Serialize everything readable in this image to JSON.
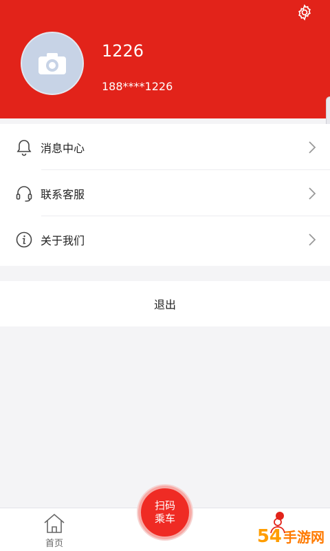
{
  "profile": {
    "username": "1226",
    "phone": "188****1226",
    "avatar_icon": "camera-icon"
  },
  "header": {
    "background": "#e2231a",
    "settings_icon": "gear-icon"
  },
  "menu": {
    "items": [
      {
        "label": "消息中心",
        "icon": "bell-icon"
      },
      {
        "label": "联系客服",
        "icon": "headset-icon"
      },
      {
        "label": "关于我们",
        "icon": "info-icon"
      }
    ]
  },
  "logout": {
    "label": "退出"
  },
  "bottom_nav": {
    "home_label": "首页",
    "scan_line1": "扫码",
    "scan_line2": "乘车",
    "accent": "#ef2b24"
  },
  "watermark": {
    "number": "54",
    "text": "手游网"
  }
}
